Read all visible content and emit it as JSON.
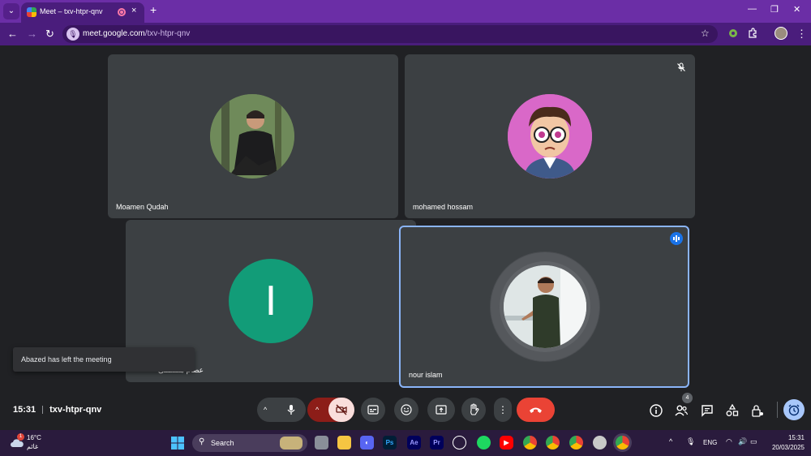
{
  "browser": {
    "tab_title": "Meet – txv-htpr-qnv",
    "tab_menu_icon": "chevron-down-icon",
    "tab_close": "×",
    "new_tab": "+",
    "url_host": "meet.google.com",
    "url_path": "/txv-htpr-qnv",
    "window_minimize": "—",
    "window_restore": "❐",
    "window_close": "✕"
  },
  "meet": {
    "participants": [
      {
        "name": "Moamen Qudah",
        "type": "photo"
      },
      {
        "name": "mohamed hossam",
        "type": "cartoon",
        "muted": true
      },
      {
        "name": "عصام مصطفى",
        "type": "initial",
        "initial": "I",
        "avatar_color": "#129c78"
      },
      {
        "name": "nour islam",
        "type": "photo",
        "speaking": true
      }
    ],
    "toast": "Abazed has left the meeting",
    "time": "15:31",
    "meeting_code": "txv-htpr-qnv",
    "people_count": "4",
    "accent_colors": {
      "end_call": "#ea4335",
      "camera_off": "#f9dedc",
      "speaking_border": "#8ab4f8",
      "toggle_bg": "#8c1d18"
    }
  },
  "taskbar": {
    "weather_temp": "16°C",
    "weather_desc": "غائم",
    "weather_badge": "1",
    "search_placeholder": "Search",
    "language": "ENG",
    "clock_time": "15:31",
    "clock_date": "20/03/2025"
  }
}
